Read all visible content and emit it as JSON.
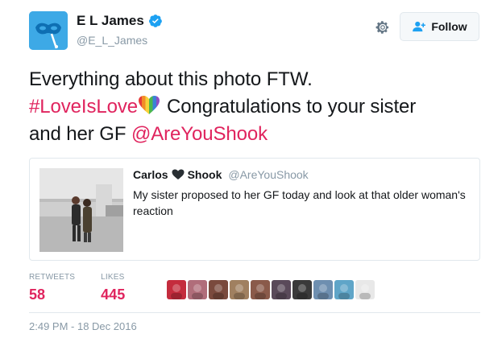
{
  "author": {
    "name": "E L James",
    "handle": "@E_L_James",
    "verified": true,
    "avatar_icon": "blue-mask-avatar",
    "avatar_color": "#3da9e6"
  },
  "actions": {
    "gear_icon": "gear-icon",
    "follow_label": "Follow",
    "follow_icon": "add-user-icon"
  },
  "tweet": {
    "line1": "Everything about this photo FTW.",
    "hashtag": "#LoveIsLove",
    "emoji": "rainbow-heart-icon",
    "after_hashtag": "Congratulations to your sister",
    "line3_prefix": "and her GF",
    "mention": "@AreYouShook"
  },
  "quote": {
    "name_first": "Carlos",
    "name_emoji": "black-heart-icon",
    "name_last": "Shook",
    "handle": "@AreYouShook",
    "text": "My sister proposed to her GF today and look at that older woman's reaction"
  },
  "stats": {
    "retweets_label": "RETWEETS",
    "retweets_value": "58",
    "likes_label": "LIKES",
    "likes_value": "445"
  },
  "likers": [
    {
      "icon": "rose-avatar",
      "color": "#c42c3d"
    },
    {
      "icon": "person-avatar",
      "color": "#b06d7a"
    },
    {
      "icon": "couple-avatar",
      "color": "#7a4a3d"
    },
    {
      "icon": "selfie-avatar",
      "color": "#a08060"
    },
    {
      "icon": "blonde-avatar",
      "color": "#8a5a4a"
    },
    {
      "icon": "face-avatar",
      "color": "#5a4a5a"
    },
    {
      "icon": "dark-avatar",
      "color": "#3a3a3a"
    },
    {
      "icon": "landscape-avatar",
      "color": "#6e8fb0"
    },
    {
      "icon": "palm-avatar",
      "color": "#5fa5c8"
    },
    {
      "icon": "white-figure-avatar",
      "color": "#e8e8e8"
    }
  ],
  "timestamp": "2:49 PM - 18 Dec 2016",
  "colors": {
    "accent_pink": "#e0245e",
    "muted_gray": "#8899a6",
    "verified_blue": "#1da1f2",
    "border": "#e1e8ed"
  }
}
